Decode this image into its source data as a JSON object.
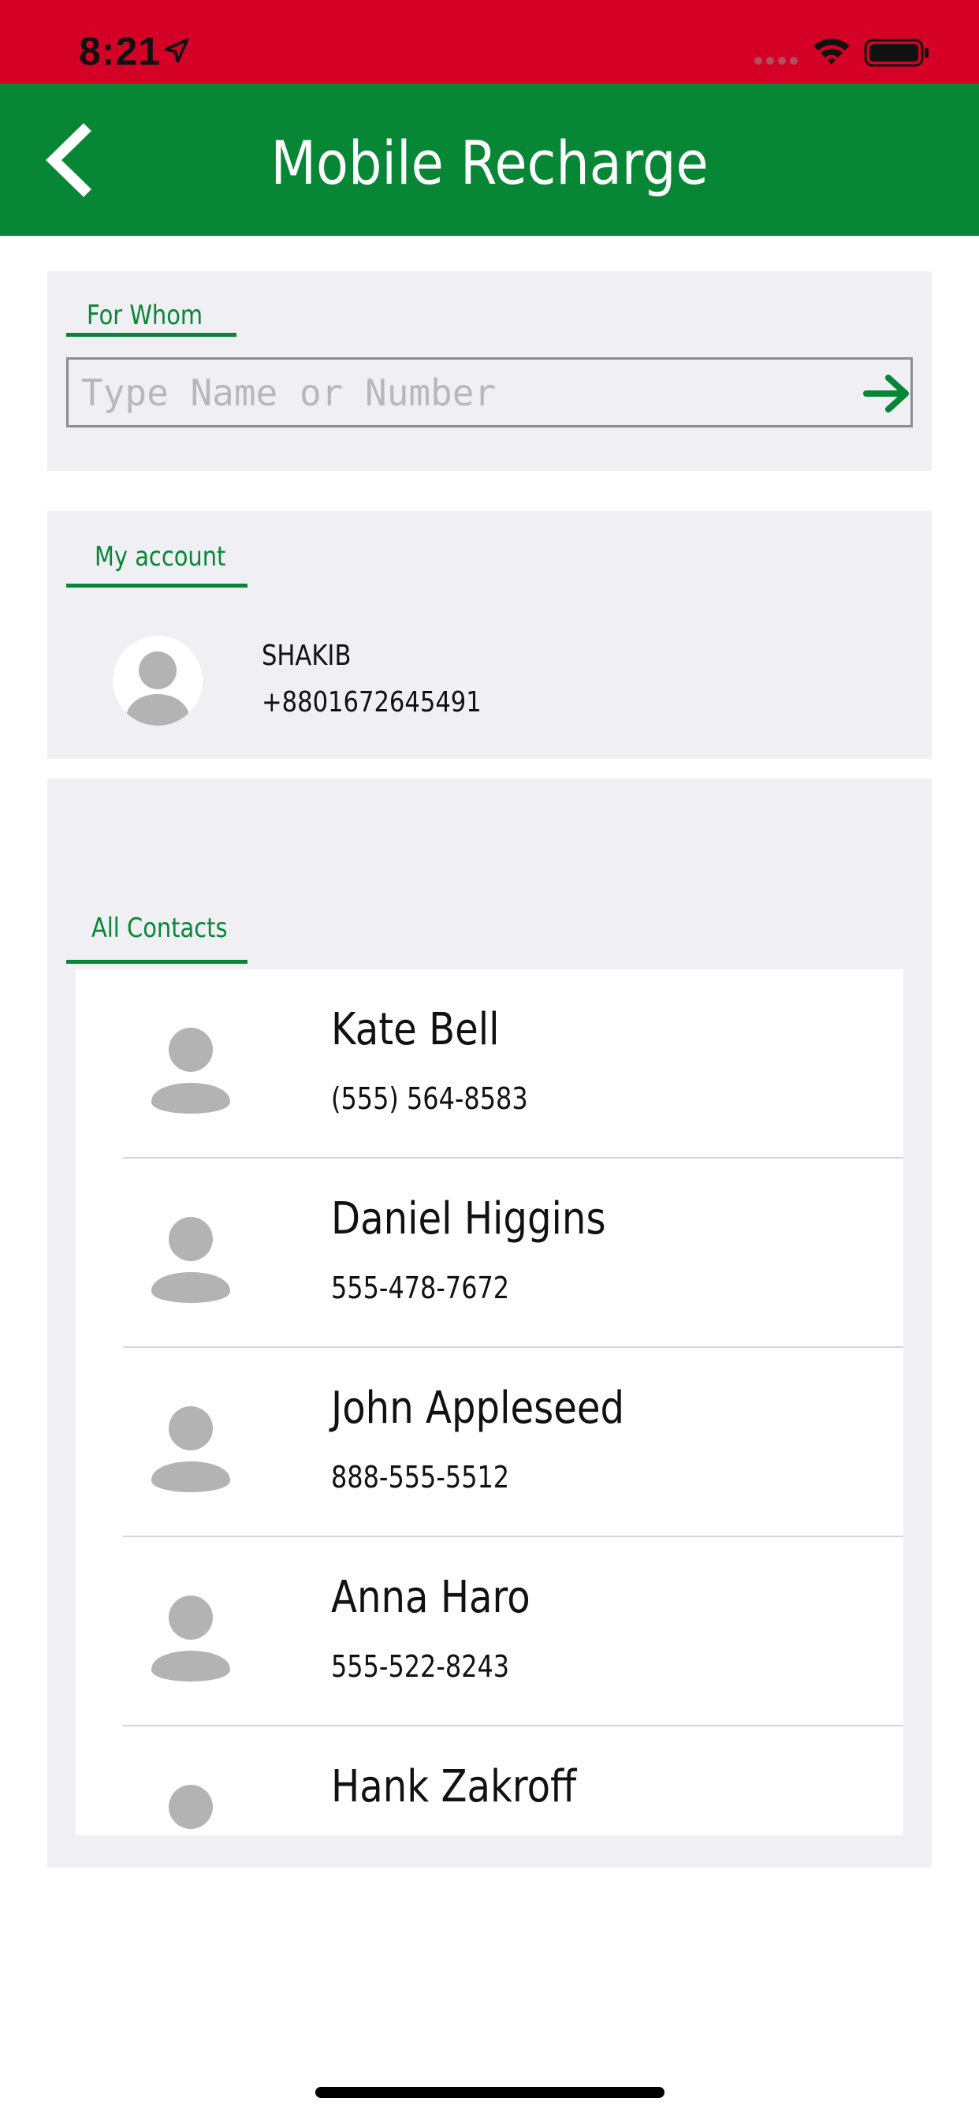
{
  "status_bar": {
    "time": "8:21",
    "background_color": "#d50026",
    "icons": [
      "location-arrow-icon",
      "signal-icon",
      "wifi-icon",
      "battery-icon"
    ]
  },
  "nav": {
    "title": "Mobile Recharge",
    "back_icon": "chevron-left-icon",
    "background_color": "#078636"
  },
  "for_whom": {
    "label": "For Whom",
    "placeholder": "Type Name or Number",
    "value": "",
    "submit_icon": "arrow-right-icon"
  },
  "my_account": {
    "label": "My account",
    "name": "SHAKIB",
    "phone": "+8801672645491",
    "avatar_icon": "person-icon"
  },
  "all_contacts": {
    "label": "All Contacts",
    "contacts": [
      {
        "name": "Kate Bell",
        "phone": "(555) 564-8583"
      },
      {
        "name": "Daniel Higgins",
        "phone": "555-478-7672"
      },
      {
        "name": "John Appleseed",
        "phone": "888-555-5512"
      },
      {
        "name": "Anna Haro",
        "phone": "555-522-8243"
      },
      {
        "name": "Hank Zakroff",
        "phone": ""
      }
    ]
  },
  "colors": {
    "accent": "#078636",
    "panel_bg": "#efeff4",
    "avatar_gray": "#b3b3b3"
  }
}
